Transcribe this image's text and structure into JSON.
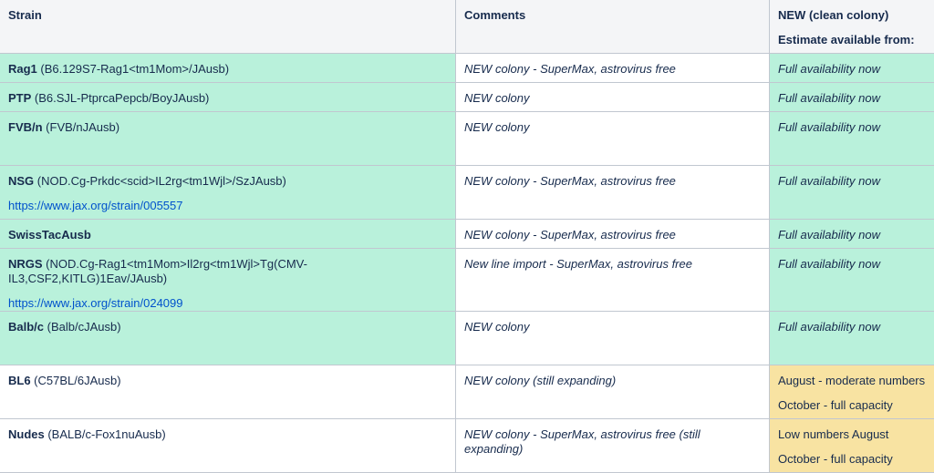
{
  "headers": {
    "strain": "Strain",
    "comments": "Comments",
    "new_line1": "NEW (clean colony)",
    "new_line2": "Estimate available from:"
  },
  "rows": [
    {
      "strain": "Rag1",
      "detail": " (B6.129S7-Rag1<tm1Mom>/JAusb)",
      "link": "",
      "comment": "NEW colony - SuperMax, astrovirus free",
      "avail": [
        "Full availability now"
      ]
    },
    {
      "strain": "PTP",
      "detail": " (B6.SJL-PtprcaPepcb/BoyJAusb)",
      "link": "",
      "comment": "NEW colony",
      "avail": [
        "Full availability now"
      ]
    },
    {
      "strain": "FVB/n",
      "detail": " (FVB/nJAusb)",
      "link": "",
      "comment": "NEW colony",
      "avail": [
        "Full availability now"
      ]
    },
    {
      "strain": "NSG",
      "detail": " (NOD.Cg-Prkdc<scid>IL2rg<tm1Wjl>/SzJAusb)",
      "link": "https://www.jax.org/strain/005557",
      "comment": "NEW colony - SuperMax, astrovirus free",
      "avail": [
        "Full availability now"
      ]
    },
    {
      "strain": "SwissTacAusb",
      "detail": "",
      "link": "",
      "comment": "NEW colony - SuperMax, astrovirus free",
      "avail": [
        "Full availability now"
      ]
    },
    {
      "strain": "NRGS",
      "detail": " (NOD.Cg-Rag1<tm1Mom>Il2rg<tm1Wjl>Tg(CMV-IL3,CSF2,KITLG)1Eav/JAusb)",
      "link": "https://www.jax.org/strain/024099",
      "comment": "New line import - SuperMax, astrovirus free",
      "avail": [
        "Full availability now"
      ]
    },
    {
      "strain": "Balb/c",
      "detail": " (Balb/cJAusb)",
      "link": "",
      "comment": "NEW colony",
      "avail": [
        "Full availability now"
      ]
    },
    {
      "strain": "BL6",
      "detail": " (C57BL/6JAusb)",
      "link": "",
      "comment": "NEW colony (still expanding)",
      "avail": [
        "August - moderate numbers",
        "October - full capacity"
      ]
    },
    {
      "strain": "Nudes",
      "detail": " (BALB/c-Fox1nuAusb)",
      "link": "",
      "comment": "NEW colony - SuperMax, astrovirus free (still expanding)",
      "avail": [
        "Low numbers August",
        "October - full capacity"
      ]
    }
  ],
  "colors": {
    "green": "#b9f1db",
    "yellow": "#f8e3a2",
    "link": "#0052cc"
  }
}
